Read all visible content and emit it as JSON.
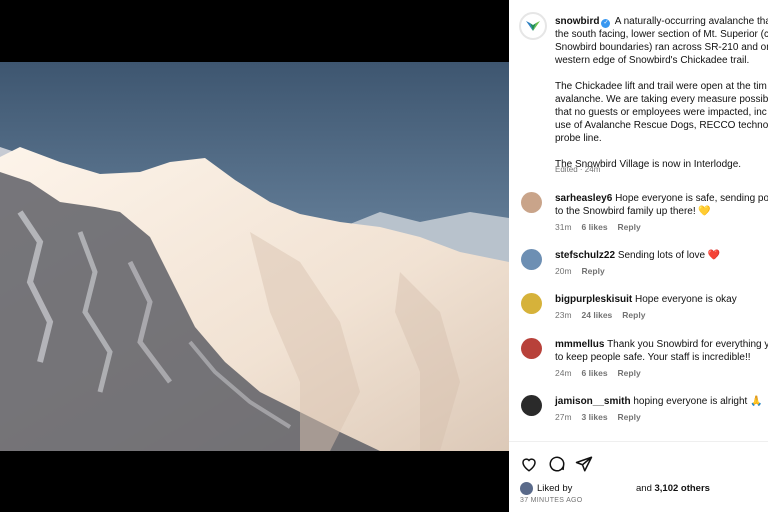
{
  "post": {
    "username": "snowbird",
    "verified_mark": "✓",
    "caption_lines_p1": [
      "A naturally-occurring avalanche tha",
      "the south facing, lower section of Mt. Superior (c",
      "Snowbird boundaries) ran across SR-210 and on",
      "western edge of Snowbird's Chickadee trail."
    ],
    "caption_lines_p2": [
      "The Chickadee lift and trail were open at the tim",
      "avalanche. We are taking every measure possibl",
      "that no guests or employees were impacted, inc",
      "use of Avalanche Rescue Dogs, RECCO technolo",
      "probe line."
    ],
    "caption_p3": "The Snowbird Village is now in Interlodge.",
    "edited_label": "Edited · 24m"
  },
  "comments": [
    {
      "username": "sarheasley6",
      "line1": "Hope everyone is safe, sending pos",
      "line2": "to the Snowbird family up there! 💛",
      "time": "31m",
      "likes": "6 likes",
      "reply": "Reply",
      "avatar_color": "#c9a48a"
    },
    {
      "username": "stefschulz22",
      "line1": "Sending lots of love ❤️",
      "line2": "",
      "time": "20m",
      "likes": "",
      "reply": "Reply",
      "avatar_color": "#6d8fb3"
    },
    {
      "username": "bigpurpleskisuit",
      "line1": "Hope everyone is okay",
      "line2": "",
      "time": "23m",
      "likes": "24 likes",
      "reply": "Reply",
      "avatar_color": "#d6b23a"
    },
    {
      "username": "mmmellus",
      "line1": "Thank you Snowbird for everything y",
      "line2": "to keep people safe. Your staff is incredible!!",
      "time": "24m",
      "likes": "6 likes",
      "reply": "Reply",
      "avatar_color": "#b8413a"
    },
    {
      "username": "jamison__smith",
      "line1": "hoping everyone is alright 🙏",
      "line2": "",
      "time": "27m",
      "likes": "3 likes",
      "reply": "Reply",
      "avatar_color": "#2a2a2a"
    }
  ],
  "footer": {
    "liked_by_label": "Liked by",
    "and_label": "and",
    "likes_count": "3,102 others",
    "time_ago": "37 MINUTES AGO"
  },
  "icons": {
    "like": "heart-icon",
    "comment": "comment-icon",
    "share": "share-icon"
  }
}
